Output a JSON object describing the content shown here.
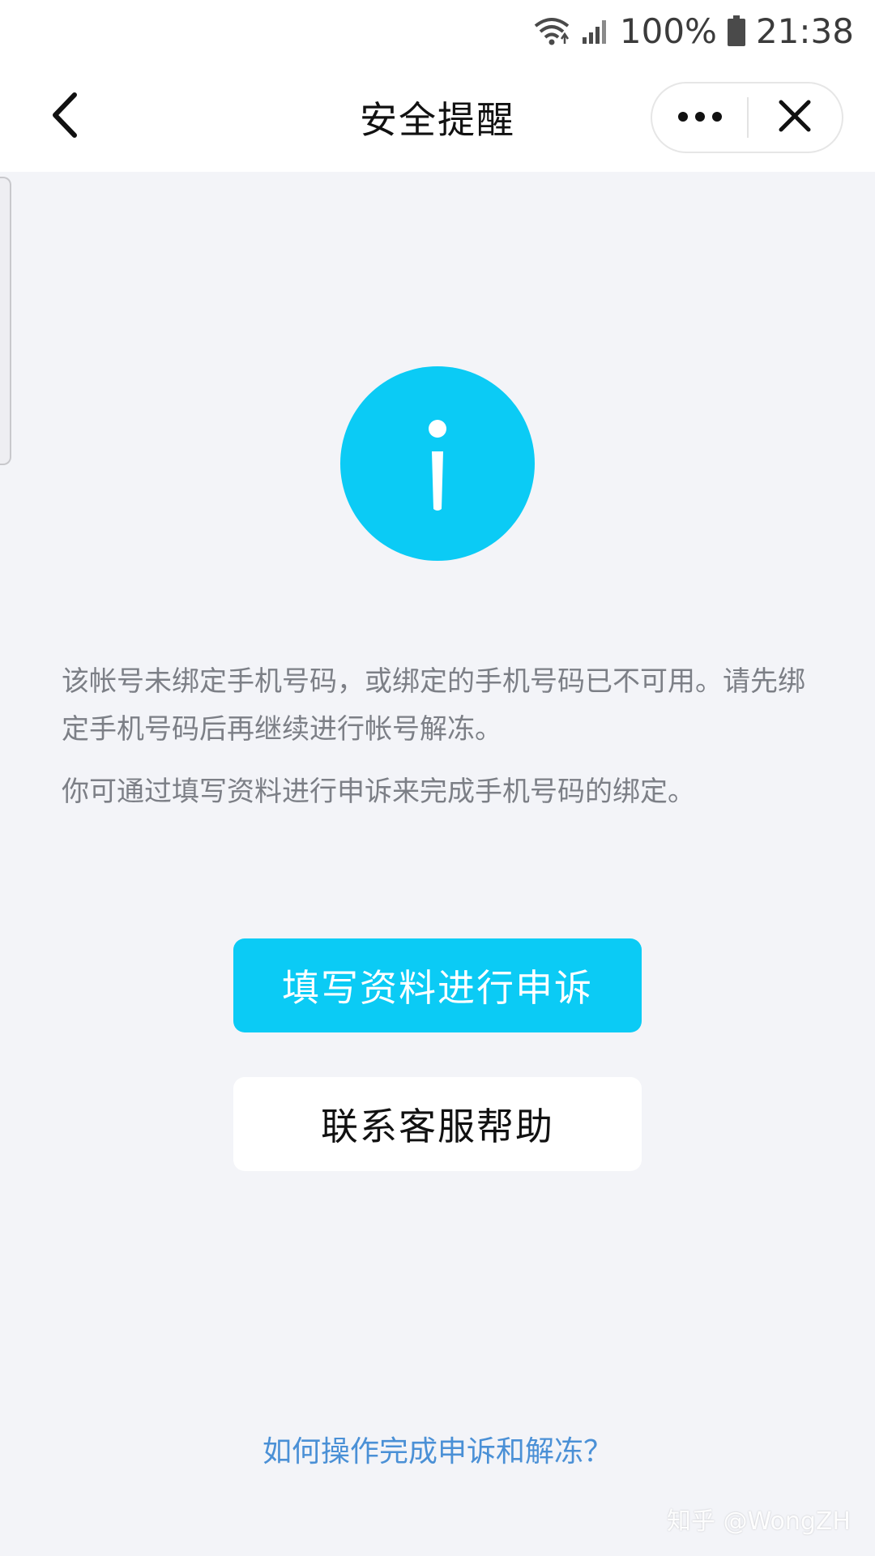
{
  "status_bar": {
    "battery_percent": "100%",
    "time": "21:38",
    "icons": [
      "wifi-icon",
      "signal-icon",
      "battery-icon"
    ]
  },
  "nav": {
    "title": "安全提醒",
    "back_icon": "chevron-left-icon",
    "more_icon": "more-dots-icon",
    "close_icon": "close-icon"
  },
  "info_icon": "info-icon",
  "message": {
    "line1": "该帐号未绑定手机号码，或绑定的手机号码已不可用。请先绑定手机号码后再继续进行帐号解冻。",
    "line2": "你可通过填写资料进行申诉来完成手机号码的绑定。"
  },
  "buttons": {
    "appeal": "填写资料进行申诉",
    "contact": "联系客服帮助"
  },
  "help_link": "如何操作完成申诉和解冻？",
  "watermark": "知乎 @WongZH",
  "colors": {
    "accent": "#0bcbf5",
    "link": "#4a90d6",
    "background": "#f3f4f8"
  }
}
